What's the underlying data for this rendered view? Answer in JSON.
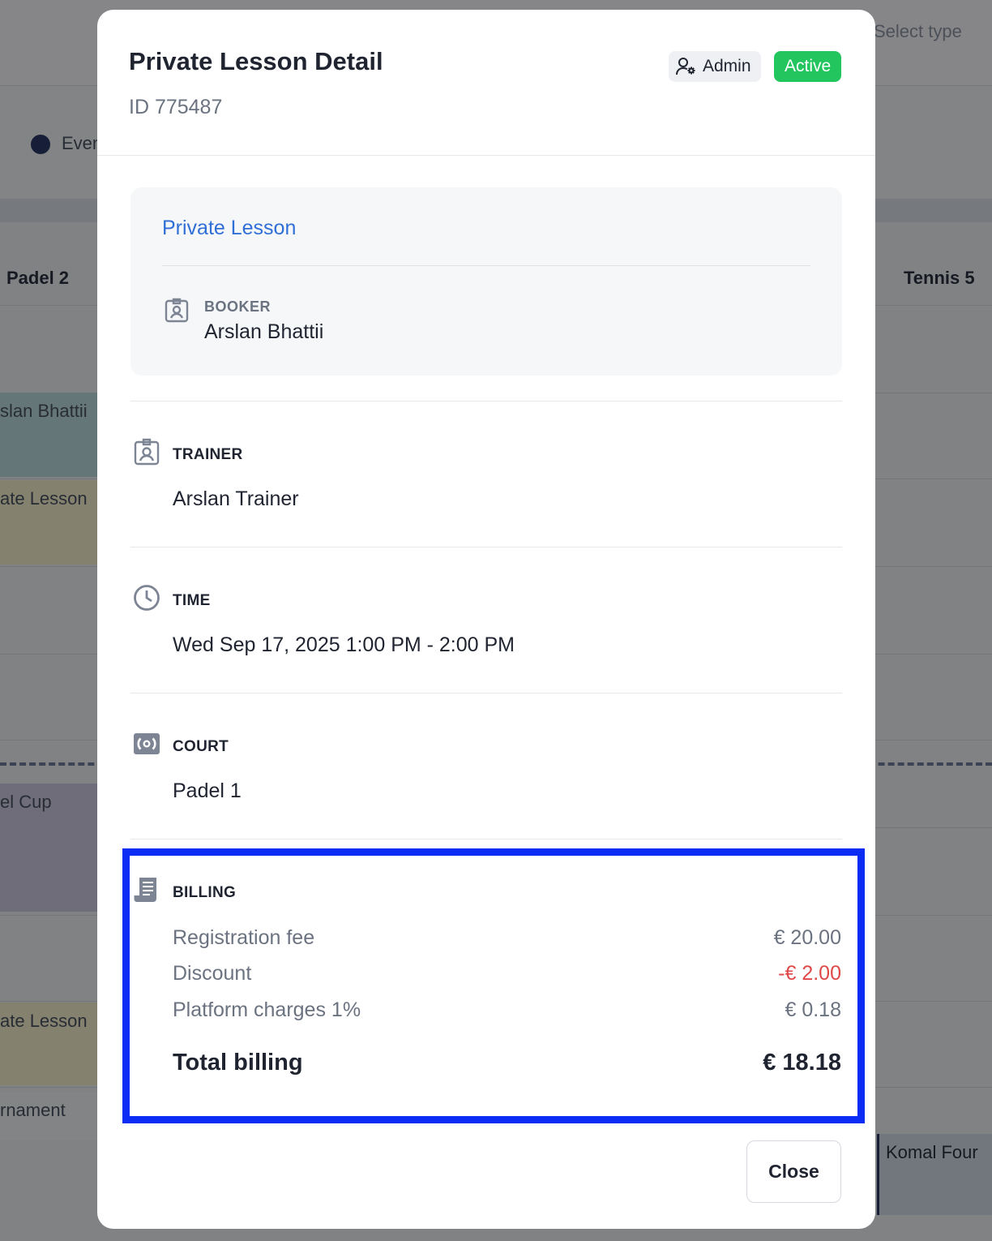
{
  "background": {
    "filter_placeholder": "Select type",
    "legend_item": "Even",
    "columns": [
      "Padel 2",
      "Tennis 5"
    ],
    "events": [
      "slan Bhattii",
      "ate Lesson",
      "el Cup",
      "ate Lesson",
      "rnament"
    ],
    "right_event": "Komal Four"
  },
  "modal": {
    "title": "Private Lesson Detail",
    "id_text": "ID 775487",
    "role_badge": "Admin",
    "status_badge": "Active",
    "status_color": "#22c55e",
    "summary": {
      "type": "Private Lesson",
      "booker_label": "BOOKER",
      "booker_name": "Arslan Bhattii"
    },
    "trainer": {
      "label": "TRAINER",
      "value": "Arslan Trainer"
    },
    "time": {
      "label": "TIME",
      "value": "Wed Sep 17, 2025 1:00 PM - 2:00 PM"
    },
    "court": {
      "label": "COURT",
      "value": "Padel 1"
    },
    "billing": {
      "label": "BILLING",
      "rows": [
        {
          "label": "Registration fee",
          "amount": "€ 20.00"
        },
        {
          "label": "Discount",
          "amount": "-€ 2.00"
        },
        {
          "label": "Platform charges 1%",
          "amount": "€ 0.18"
        }
      ],
      "total_label": "Total billing",
      "total_amount": "€ 18.18",
      "highlight_color": "#0a2cf5"
    },
    "close_label": "Close"
  }
}
